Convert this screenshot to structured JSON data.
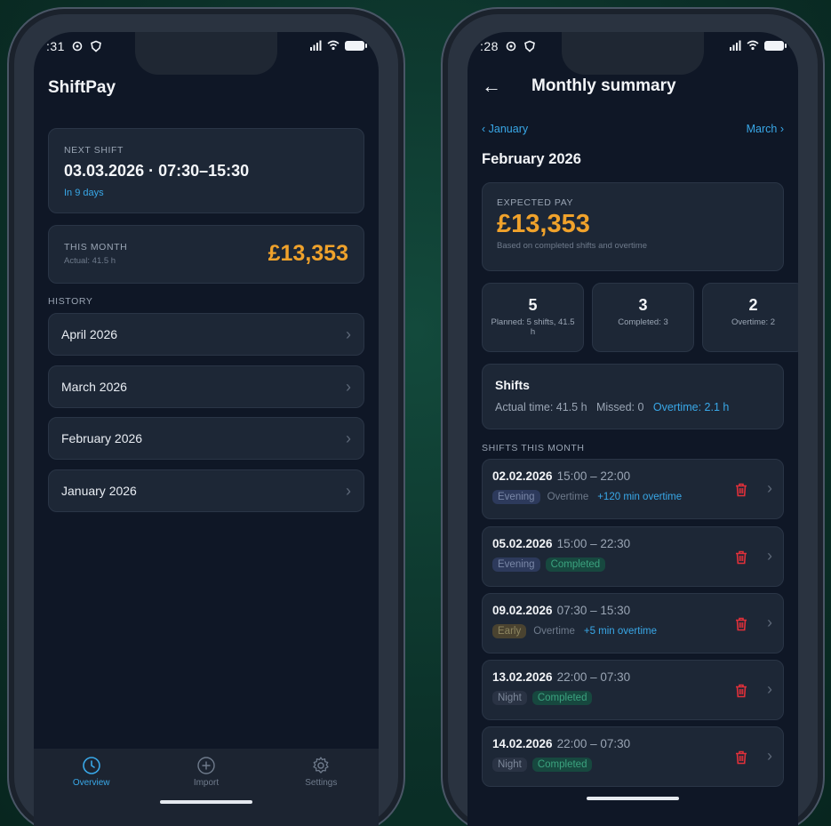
{
  "left_phone": {
    "status_time": ":31",
    "app_title": "ShiftPay",
    "next_shift": {
      "label": "NEXT SHIFT",
      "datetime": "03.03.2026 · 07:30–15:30",
      "countdown": "In 9 days"
    },
    "this_month": {
      "label": "THIS MONTH",
      "actual": "Actual: 41.5 h",
      "amount": "£13,353"
    },
    "history_label": "HISTORY",
    "history": [
      {
        "label": "April 2026"
      },
      {
        "label": "March 2026"
      },
      {
        "label": "February 2026"
      },
      {
        "label": "January 2026"
      }
    ],
    "tabs": [
      {
        "label": "Overview",
        "icon": "clock-icon",
        "active": true
      },
      {
        "label": "Import",
        "icon": "plus-circle-icon",
        "active": false
      },
      {
        "label": "Settings",
        "icon": "gear-icon",
        "active": false
      }
    ]
  },
  "right_phone": {
    "status_time": ":28",
    "title": "Monthly summary",
    "prev_month": "January",
    "next_month": "March",
    "month_title": "February 2026",
    "expected": {
      "label": "EXPECTED PAY",
      "amount": "£13,353",
      "note": "Based on completed shifts and overtime"
    },
    "stats": [
      {
        "value": "5",
        "caption": "Planned: 5 shifts, 41.5 h"
      },
      {
        "value": "3",
        "caption": "Completed: 3"
      },
      {
        "value": "2",
        "caption": "Overtime: 2"
      }
    ],
    "shifts_summary": {
      "heading": "Shifts",
      "actual": "Actual time: 41.5 h",
      "missed": "Missed: 0",
      "overtime": "Overtime: 2.1 h"
    },
    "shifts_label": "SHIFTS THIS MONTH",
    "shifts": [
      {
        "date": "02.02.2026",
        "time": "15:00 – 22:00",
        "type": "Evening",
        "status": "Overtime",
        "extra": "+120 min overtime"
      },
      {
        "date": "05.02.2026",
        "time": "15:00 – 22:30",
        "type": "Evening",
        "status": "Completed",
        "extra": ""
      },
      {
        "date": "09.02.2026",
        "time": "07:30 – 15:30",
        "type": "Early",
        "status": "Overtime",
        "extra": "+5 min overtime"
      },
      {
        "date": "13.02.2026",
        "time": "22:00 – 07:30",
        "type": "Night",
        "status": "Completed",
        "extra": ""
      },
      {
        "date": "14.02.2026",
        "time": "22:00 – 07:30",
        "type": "Night",
        "status": "Completed",
        "extra": ""
      }
    ]
  },
  "colors": {
    "accent_blue": "#39a8e8",
    "accent_orange": "#f0a22b",
    "delete_red": "#e0303a",
    "completed_green": "#3ba37f"
  }
}
